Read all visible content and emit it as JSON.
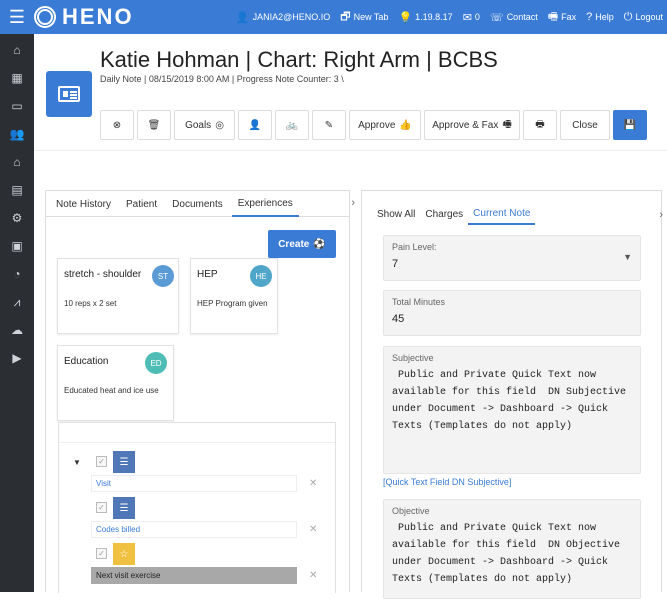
{
  "topbar": {
    "brand": "HENO",
    "user": "JANIA2@HENO.IO",
    "new_tab": "New Tab",
    "version": "1.19.8.17",
    "mail_count": "0",
    "contact": "Contact",
    "fax": "Fax",
    "help": "Help",
    "logout": "Logout"
  },
  "header": {
    "title": "Katie Hohman | Chart: Right Arm | BCBS",
    "subtitle": "Daily Note | 08/15/2019 8:00 AM | Progress Note Counter: 3  \\"
  },
  "toolbar": {
    "goals": "Goals",
    "approve": "Approve",
    "approve_fax": "Approve & Fax",
    "close": "Close"
  },
  "left_tabs": [
    "Note History",
    "Patient",
    "Documents",
    "Experiences"
  ],
  "create_label": "Create",
  "experiences": [
    {
      "title": "stretch - shoulder",
      "initials": "ST",
      "detail": "10 reps x 2 set",
      "color": "#5b9bd5"
    },
    {
      "title": "HEP",
      "initials": "HE",
      "detail": "HEP Program given",
      "color": "#4fa6c8"
    },
    {
      "title": "Education",
      "initials": "ED",
      "detail": "Educated heat and ice use",
      "color": "#4dbdb6"
    }
  ],
  "tree": [
    {
      "label": "Visit",
      "check": "✓"
    },
    {
      "label": "Codes billed",
      "check": "✓"
    },
    {
      "label": "Next visit exercise",
      "check": "✓"
    }
  ],
  "right_tabs": [
    "Show All",
    "Charges",
    "Current Note"
  ],
  "fields": {
    "pain_label": "Pain Level:",
    "pain_value": "7",
    "minutes_label": "Total Minutes",
    "minutes_value": "45",
    "subjective_label": "Subjective",
    "subjective_text": " Public and Private Quick Text now\navailable for this field  DN Subjective\nunder Document -> Dashboard -> Quick\nTexts (Templates do not apply)",
    "quick_link": "[Quick Text Field DN Subjective]",
    "objective_label": "Objective",
    "objective_text": " Public and Private Quick Text now\navailable for this field  DN Objective\nunder Document -> Dashboard -> Quick\nTexts (Templates do not apply)"
  },
  "colors": {
    "brand": "#3a7bd5",
    "sidebar": "#2b2e33"
  }
}
